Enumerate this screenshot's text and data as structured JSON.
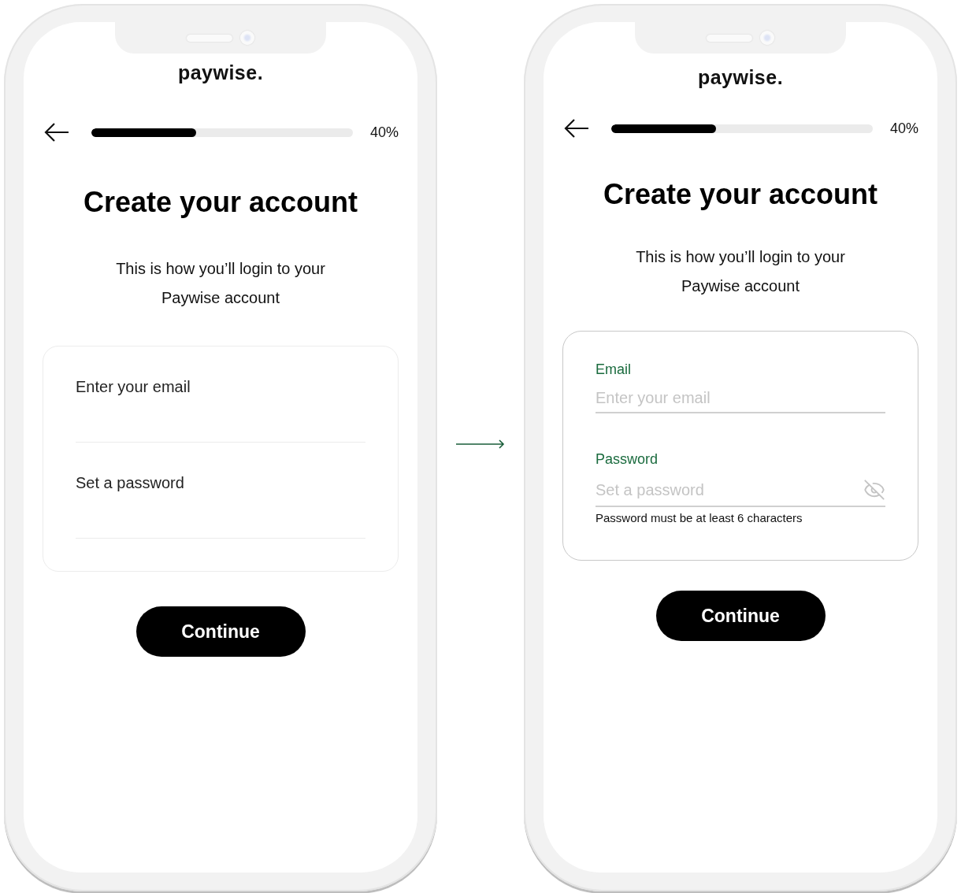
{
  "screens": [
    {
      "kind": "plain",
      "logo": "paywise.",
      "progress": {
        "level": 0.4,
        "reading": "40%"
      },
      "title": "Create your account",
      "subtitle": "This is how you’ll login to your Paywise account",
      "fields": [
        {
          "placeholder": "Enter your email"
        },
        {
          "placeholder": "Set a password"
        }
      ],
      "button": "Continue"
    },
    {
      "kind": "labeled",
      "logo": "paywise.",
      "progress": {
        "level": 0.4,
        "reading": "40%"
      },
      "title": "Create your account",
      "subtitle": "This is how you’ll login to your Paywise account",
      "fields": [
        {
          "label": "Email",
          "placeholder": "Enter your email"
        },
        {
          "label": "Password",
          "placeholder": "Set a password",
          "eye_toggle": true,
          "hint": "Password must be at least 6 characters"
        }
      ],
      "button": "Continue"
    }
  ]
}
